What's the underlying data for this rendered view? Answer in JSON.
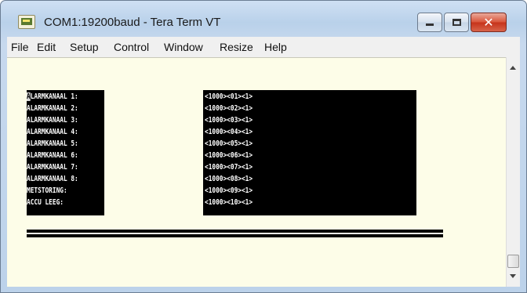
{
  "window": {
    "title": "COM1:19200baud - Tera Term VT",
    "minimize_glyph": "",
    "maximize_glyph": "",
    "close_glyph": "✕"
  },
  "menubar": {
    "items": [
      "File",
      "Edit",
      "Setup",
      "Control",
      "Window",
      "Resize",
      "Help"
    ]
  },
  "terminal": {
    "cursor_char": "A",
    "labels": [
      "ALARMKANAAL 1:",
      "ALARMKANAAL 2:",
      "ALARMKANAAL 3:",
      "ALARMKANAAL 4:",
      "ALARMKANAAL 5:",
      "ALARMKANAAL 6:",
      "ALARMKANAAL 7:",
      "ALARMKANAAL 8:",
      "METSTORING:",
      "ACCU LEEG:"
    ],
    "values": [
      "<1000><01><1>",
      "<1000><02><1>",
      "<1000><03><1>",
      "<1000><04><1>",
      "<1000><05><1>",
      "<1000><06><1>",
      "<1000><07><1>",
      "<1000><08><1>",
      "<1000><09><1>",
      "<1000><10><1>"
    ]
  },
  "colors": {
    "terminal_background": "#fdfde8",
    "text": "#ffffff",
    "reverse_background": "#000000",
    "close_button": "#c6331a"
  },
  "icons": {
    "app": "tera-term-icon",
    "minimize": "minimize-icon",
    "maximize": "maximize-icon",
    "close": "close-icon",
    "scroll_up": "arrow-up-icon",
    "scroll_down": "arrow-down-icon"
  }
}
